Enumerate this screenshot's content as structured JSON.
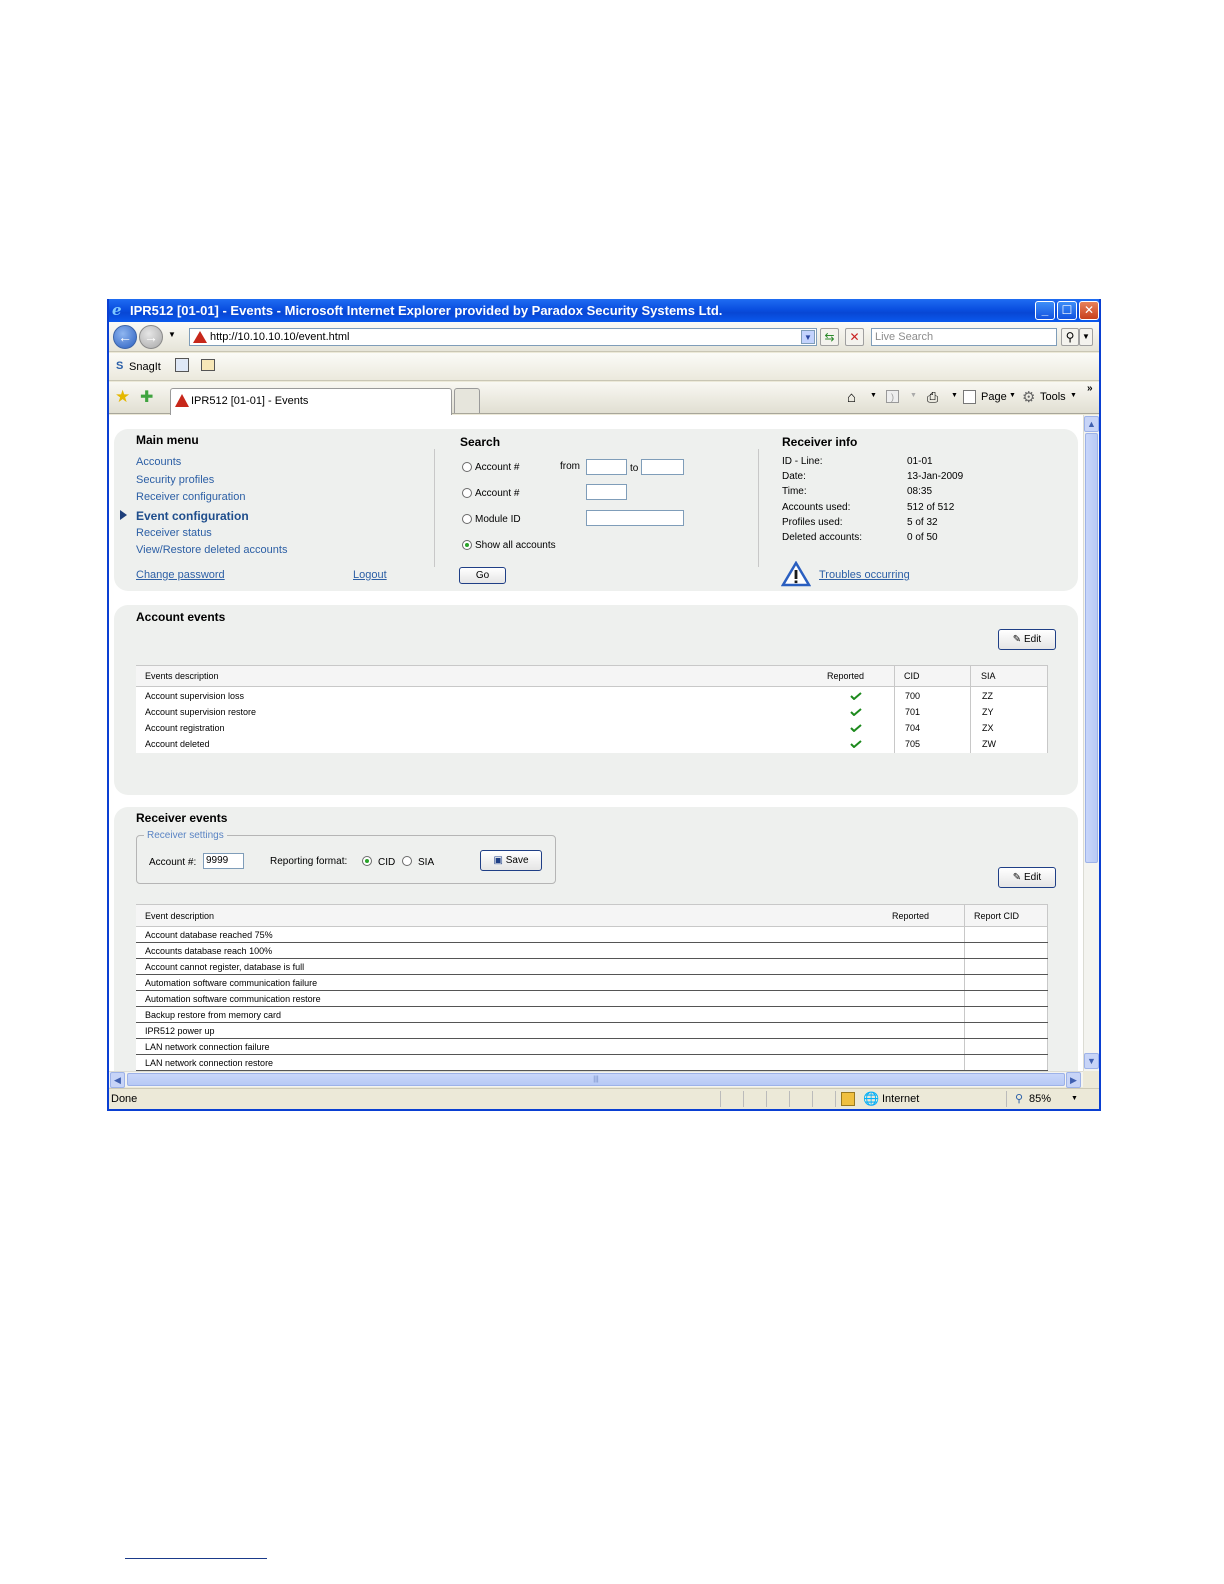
{
  "window": {
    "title": "IPR512 [01-01] - Events - Microsoft Internet Explorer provided by Paradox Security Systems Ltd.",
    "url": "http://10.10.10.10/event.html",
    "search_placeholder": "Live Search",
    "links": {
      "snagit": "SnagIt"
    },
    "tab_title": "IPR512 [01-01] - Events",
    "toolbar": {
      "page": "Page",
      "tools": "Tools"
    },
    "status": {
      "left": "Done",
      "zone": "Internet",
      "zoom": "85%"
    }
  },
  "main_menu": {
    "title": "Main menu",
    "items": [
      "Accounts",
      "Security profiles",
      "Receiver configuration",
      "Event configuration",
      "Receiver status",
      "View/Restore deleted accounts"
    ],
    "change_password": "Change password",
    "logout": "Logout"
  },
  "search": {
    "title": "Search",
    "opt_range": "Account #",
    "from": "from",
    "to": "to",
    "opt_account": "Account #",
    "opt_module": "Module ID",
    "opt_all": "Show all accounts",
    "go": "Go"
  },
  "receiver_info": {
    "title": "Receiver info",
    "rows": [
      {
        "label": "ID - Line:",
        "value": "01-01"
      },
      {
        "label": "Date:",
        "value": "13-Jan-2009"
      },
      {
        "label": "Time:",
        "value": "08:35"
      },
      {
        "label": "Accounts used:",
        "value": "512 of 512"
      },
      {
        "label": "Profiles used:",
        "value": "5 of 32"
      },
      {
        "label": "Deleted accounts:",
        "value": "0 of 50"
      }
    ],
    "troubles": "Troubles occurring"
  },
  "account_events": {
    "title": "Account events",
    "edit": "Edit",
    "headers": {
      "desc": "Events description",
      "reported": "Reported",
      "cid": "CID",
      "sia": "SIA"
    },
    "rows": [
      {
        "desc": "Account supervision loss",
        "cid": "700",
        "sia": "ZZ"
      },
      {
        "desc": "Account supervision restore",
        "cid": "701",
        "sia": "ZY"
      },
      {
        "desc": "Account registration",
        "cid": "704",
        "sia": "ZX"
      },
      {
        "desc": "Account deleted",
        "cid": "705",
        "sia": "ZW"
      }
    ]
  },
  "receiver_events": {
    "title": "Receiver events",
    "settings_legend": "Receiver settings",
    "account_label": "Account #:",
    "account_value": "9999",
    "format_label": "Reporting format:",
    "cid": "CID",
    "sia": "SIA",
    "save": "Save",
    "edit": "Edit",
    "headers": {
      "desc": "Event description",
      "reported": "Reported",
      "report_cid": "Report CID"
    },
    "rows": [
      "Account database reached 75%",
      "Accounts database reach 100%",
      "Account cannot register, database is full",
      "Automation software communication failure",
      "Automation software communication restore",
      "Backup restore from memory card",
      "IPR512 power up",
      "LAN network connection failure",
      "LAN network connection restore"
    ]
  }
}
